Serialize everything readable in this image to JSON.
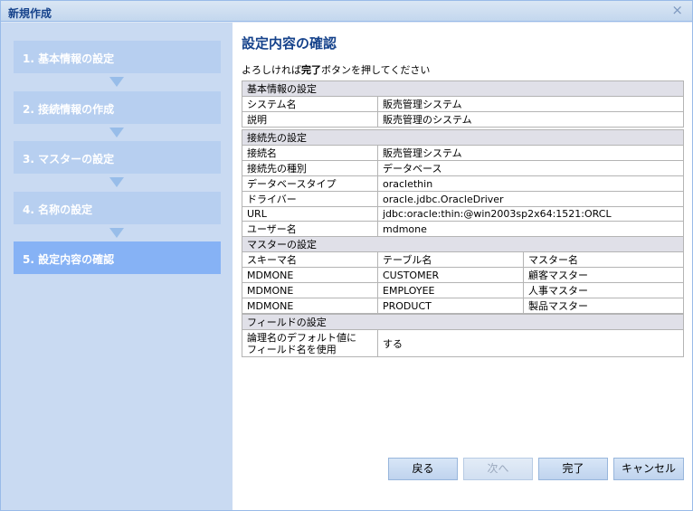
{
  "window": {
    "title": "新規作成",
    "close_glyph": "×"
  },
  "steps": [
    {
      "label": "1. 基本情報の設定",
      "active": false
    },
    {
      "label": "2. 接続情報の作成",
      "active": false
    },
    {
      "label": "3. マスターの設定",
      "active": false
    },
    {
      "label": "4. 名称の設定",
      "active": false
    },
    {
      "label": "5. 設定内容の確認",
      "active": true
    }
  ],
  "content": {
    "heading": "設定内容の確認",
    "instruction_pre": "よろしければ",
    "instruction_bold": "完了",
    "instruction_post": "ボタンを押してください"
  },
  "basic": {
    "header": "基本情報の設定",
    "rows": [
      {
        "k": "システム名",
        "v": "販売管理システム"
      },
      {
        "k": "説明",
        "v": "販売管理のシステム"
      }
    ]
  },
  "connection": {
    "header": "接続先の設定",
    "rows": [
      {
        "k": "接続名",
        "v": "販売管理システム"
      },
      {
        "k": "接続先の種別",
        "v": "データベース"
      },
      {
        "k": "データベースタイプ",
        "v": "oraclethin"
      },
      {
        "k": "ドライバー",
        "v": "oracle.jdbc.OracleDriver"
      },
      {
        "k": "URL",
        "v": "jdbc:oracle:thin:@win2003sp2x64:1521:ORCL"
      },
      {
        "k": "ユーザー名",
        "v": "mdmone"
      }
    ]
  },
  "master": {
    "header": "マスターの設定",
    "columns": [
      "スキーマ名",
      "テーブル名",
      "マスター名"
    ],
    "rows": [
      [
        "MDMONE",
        "CUSTOMER",
        "顧客マスター"
      ],
      [
        "MDMONE",
        "EMPLOYEE",
        "人事マスター"
      ],
      [
        "MDMONE",
        "PRODUCT",
        "製品マスター"
      ]
    ]
  },
  "field": {
    "header": "フィールドの設定",
    "k_line1": "論理名のデフォルト値に",
    "k_line2": "フィールド名を使用",
    "v": "する"
  },
  "buttons": {
    "back": "戻る",
    "next": "次へ",
    "finish": "完了",
    "cancel": "キャンセル"
  },
  "colors": {
    "accent": "#15428b",
    "active_step": "#86b2f5",
    "inactive_step": "#b7cff0"
  },
  "icons": {
    "close": "close-icon",
    "arrow": "arrow-down-icon"
  }
}
